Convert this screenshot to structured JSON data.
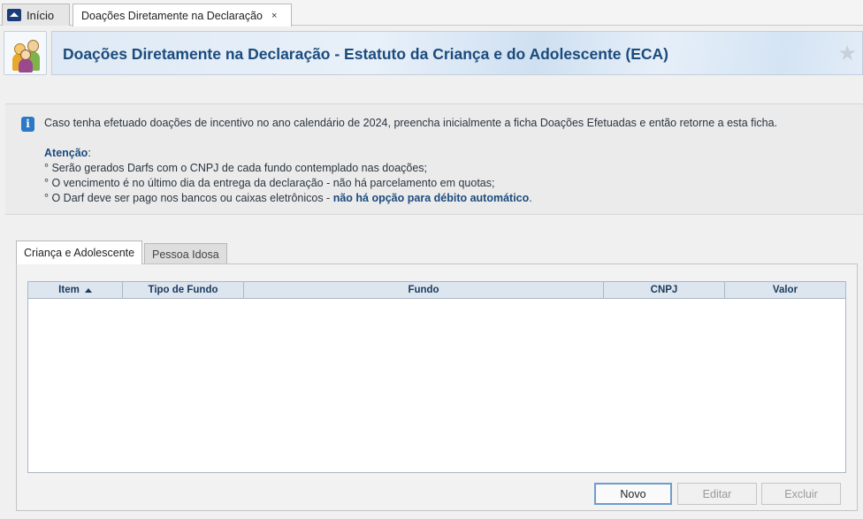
{
  "tabs": {
    "home_label": "Início",
    "active_label": "Doações Diretamente na Declaração",
    "close_glyph": "×"
  },
  "header": {
    "title": "Doações Diretamente na Declaração - Estatuto da Criança e do Adolescente (ECA)",
    "favorite_icon": "star-icon"
  },
  "info": {
    "line1": "Caso tenha efetuado doações de incentivo no ano calendário de 2024, preencha inicialmente a ficha Doações Efetuadas e então retorne a esta ficha.",
    "attention_label": "Atenção",
    "attention_colon": ":",
    "bullet1": "° Serão gerados Darfs com o CNPJ de cada fundo contemplado nas doações;",
    "bullet2": "° O vencimento é no último dia da entrega da declaração - não há parcelamento em quotas;",
    "bullet3_prefix": "° O Darf deve ser pago nos bancos ou caixas eletrônicos - ",
    "bullet3_bold": "não há opção para débito automático",
    "bullet3_suffix": "."
  },
  "panel_tabs": {
    "tab1": "Criança e Adolescente",
    "tab2": "Pessoa Idosa"
  },
  "table": {
    "columns": [
      "Item",
      "Tipo de Fundo",
      "Fundo",
      "CNPJ",
      "Valor"
    ],
    "rows": []
  },
  "buttons": {
    "new": "Novo",
    "edit": "Editar",
    "delete": "Excluir"
  },
  "colors": {
    "title": "#1b4b7d",
    "info_icon": "#2a78c6",
    "primary_border": "#6f9ccf"
  }
}
